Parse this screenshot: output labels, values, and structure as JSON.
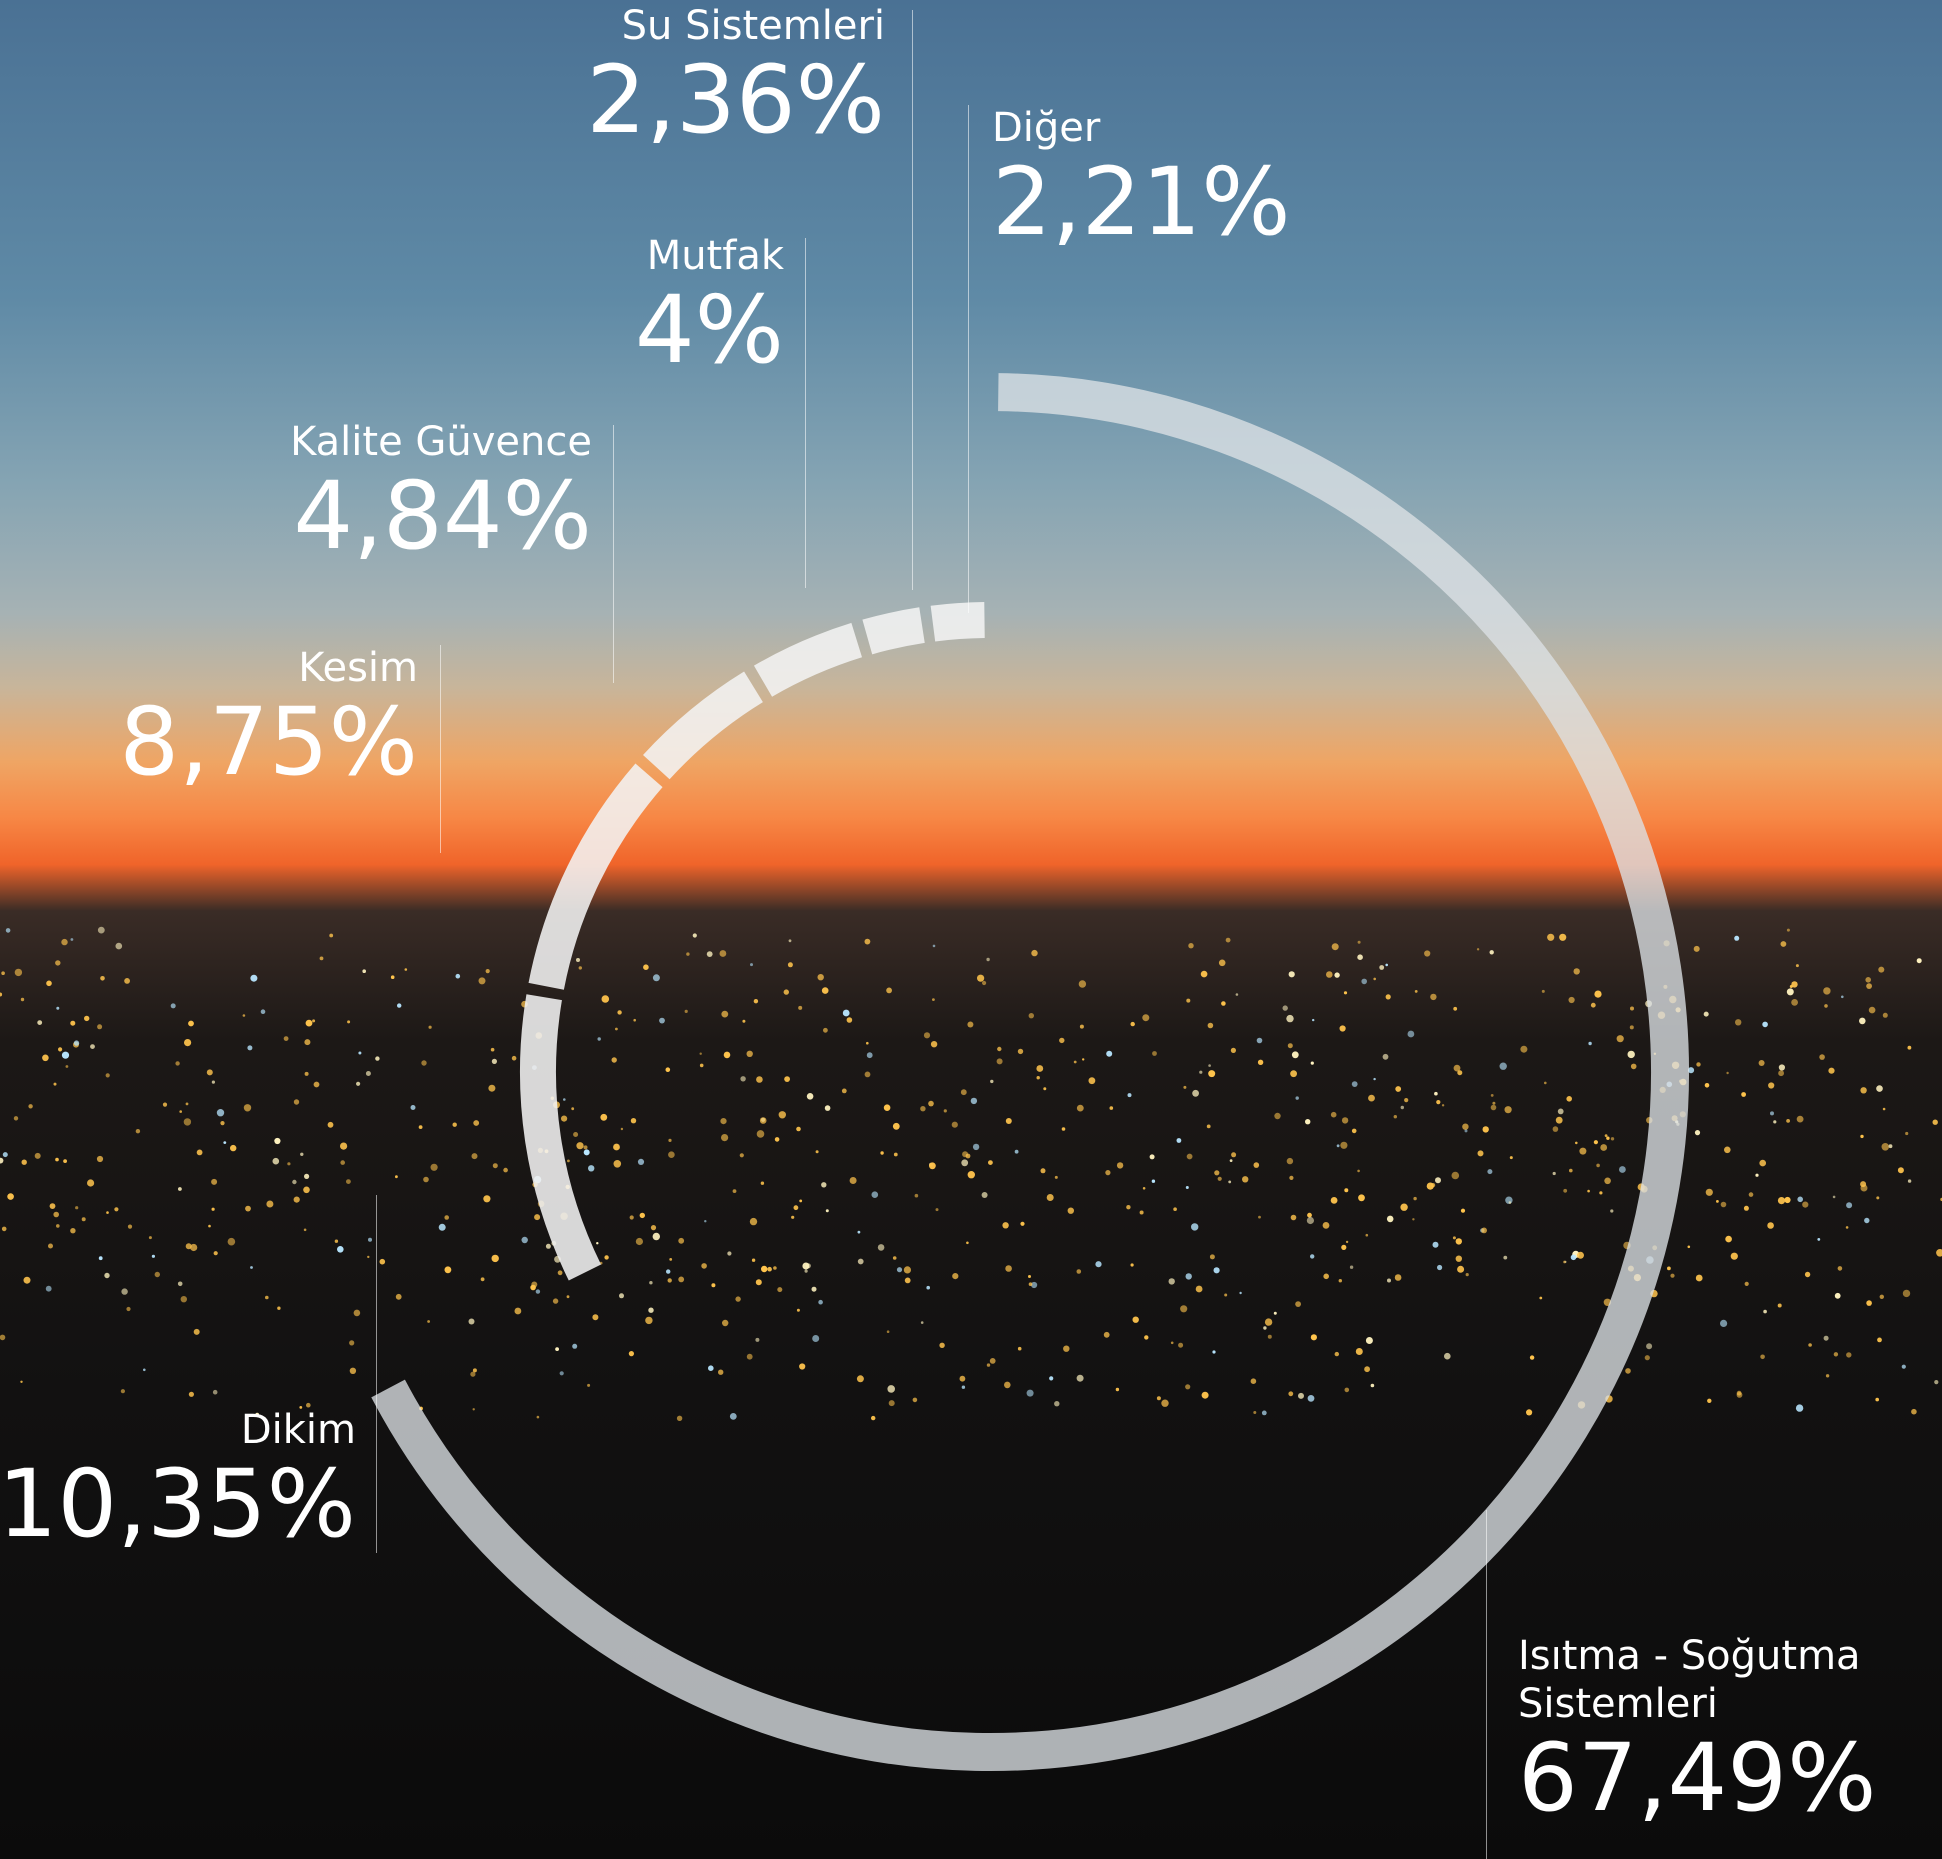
{
  "chart_data": {
    "type": "pie",
    "style": "segmented ring (donut outline) over a dusk city skyline photo",
    "unit": "%",
    "decimal_separator": ",",
    "slices": [
      {
        "label": "Isıtma - Soğutma Sistemleri",
        "value": 67.49,
        "display": "67,49%"
      },
      {
        "label": "Dikim",
        "value": 10.35,
        "display": "10,35%"
      },
      {
        "label": "Kesim",
        "value": 8.75,
        "display": "8,75%"
      },
      {
        "label": "Kalite Güvence",
        "value": 4.84,
        "display": "4,84%"
      },
      {
        "label": "Mutfak",
        "value": 4,
        "display": "4%"
      },
      {
        "label": "Su Sistemleri",
        "value": 2.36,
        "display": "2,36%"
      },
      {
        "label": "Diğer",
        "value": 2.21,
        "display": "2,21%"
      }
    ],
    "colors": {
      "ring_main": "#dce2e6",
      "ring_small": "#f2f2f2",
      "text": "#ffffff",
      "sky_top": "#4a7194",
      "horizon": "#f0642a",
      "ground": "#0b0b0b",
      "city_lights": "#ffc44d"
    }
  },
  "labels": {
    "heating_line1": "Isıtma - Soğutma",
    "heating_line2": "Sistemleri"
  }
}
